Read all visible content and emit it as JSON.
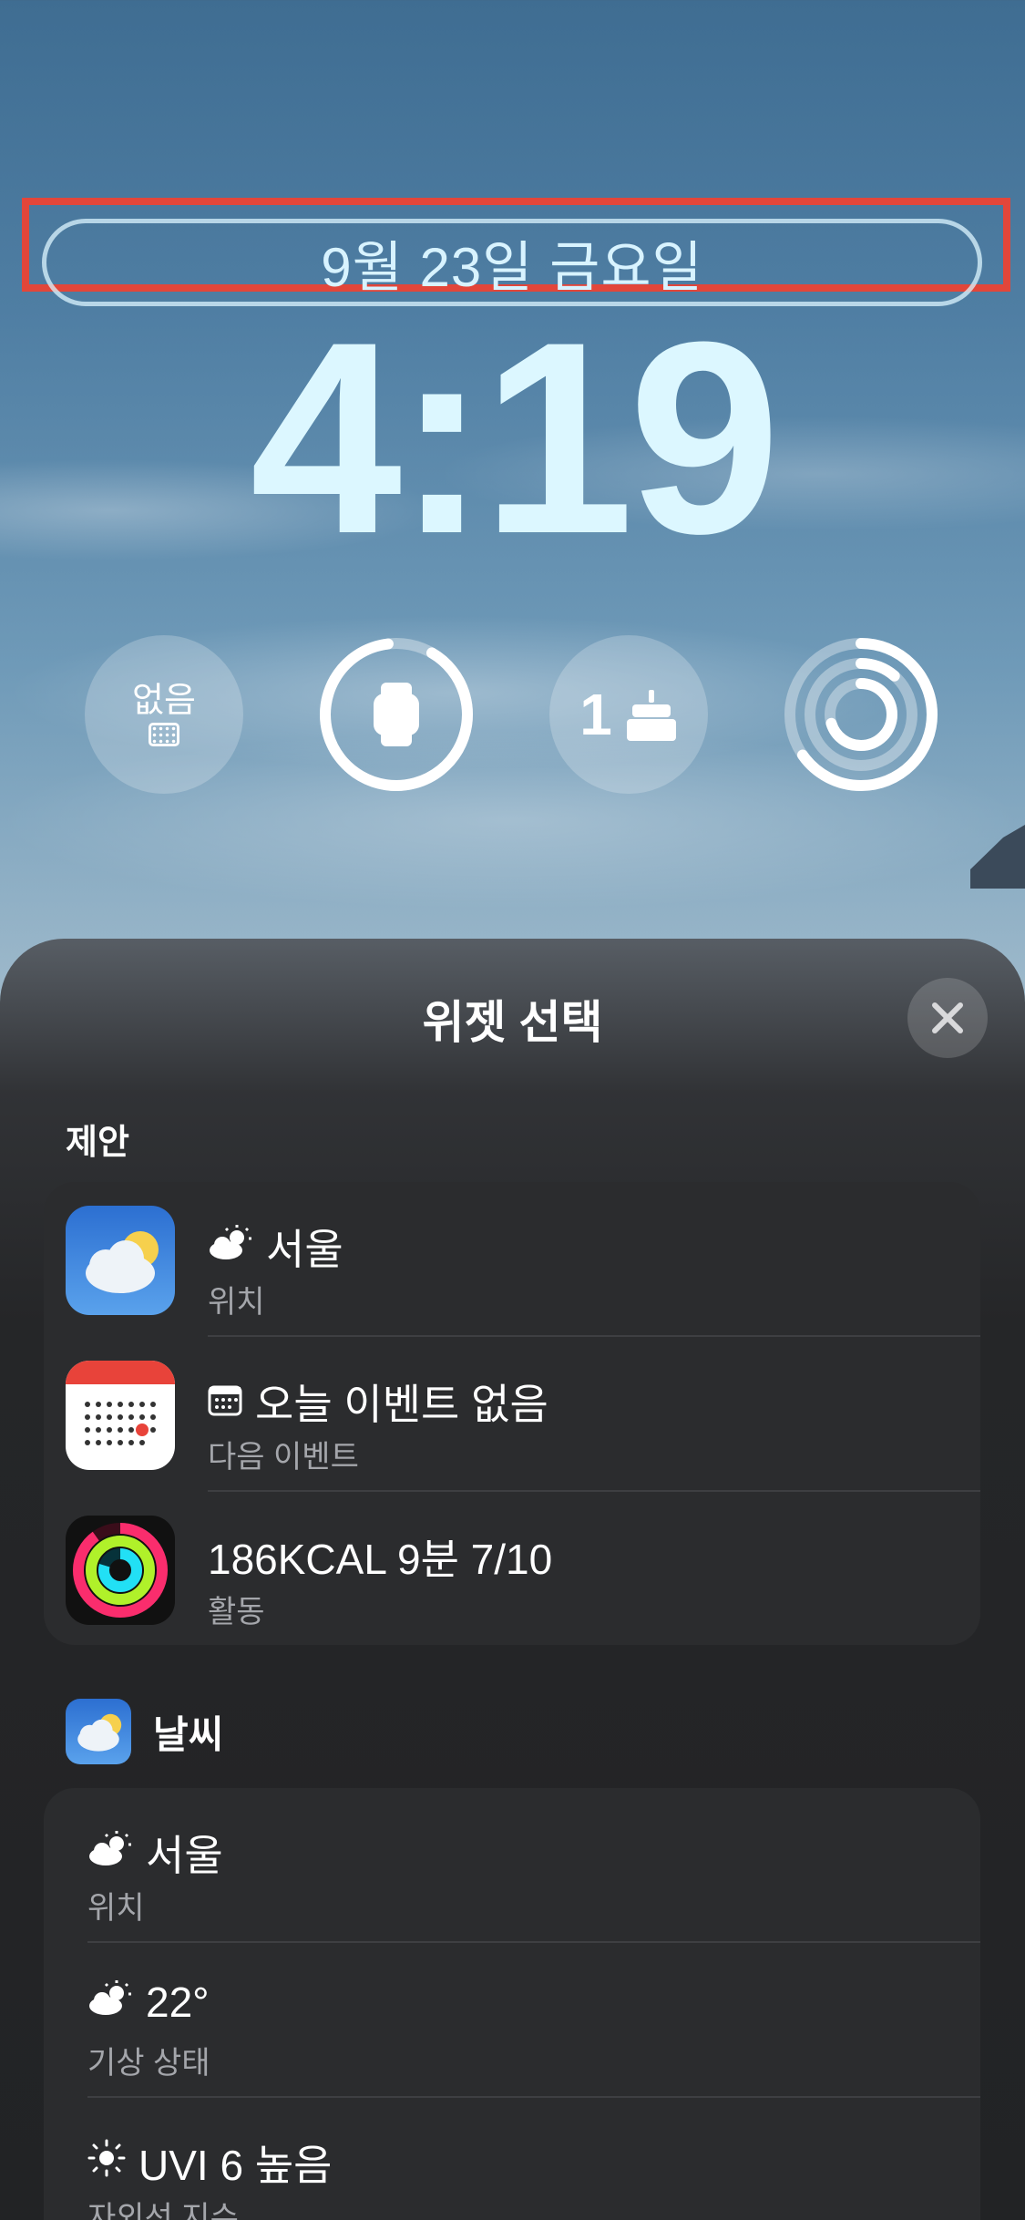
{
  "lock_screen": {
    "date": "9월 23일 금요일",
    "time": "4:19",
    "widgets": {
      "calendar_text": "없음",
      "birthday_count": "1"
    }
  },
  "sheet": {
    "title": "위젯 선택",
    "suggestions_label": "제안",
    "suggestions": [
      {
        "icon": "weather-app-icon",
        "title_icon": "partly-sunny-icon",
        "title": "서울",
        "subtitle": "위치"
      },
      {
        "icon": "calendar-app-icon",
        "title_icon": "calendar-small-icon",
        "title": "오늘 이벤트 없음",
        "subtitle": "다음 이벤트"
      },
      {
        "icon": "activity-app-icon",
        "title": "186KCAL 9분 7/10",
        "subtitle": "활동"
      }
    ],
    "weather_app": {
      "name": "날씨",
      "items": [
        {
          "title_icon": "partly-sunny-icon",
          "title": "서울",
          "subtitle": "위치"
        },
        {
          "title_icon": "partly-sunny-icon",
          "title": "22°",
          "subtitle": "기상 상태"
        },
        {
          "title_icon": "sun-icon",
          "title": "UVI 6 높음",
          "subtitle": "자외선 지수"
        }
      ]
    }
  },
  "colors": {
    "highlight": "#e2463a",
    "clock": "#dcf7ff",
    "sheet_bg": "#222325",
    "card_bg": "#2b2c2e"
  }
}
